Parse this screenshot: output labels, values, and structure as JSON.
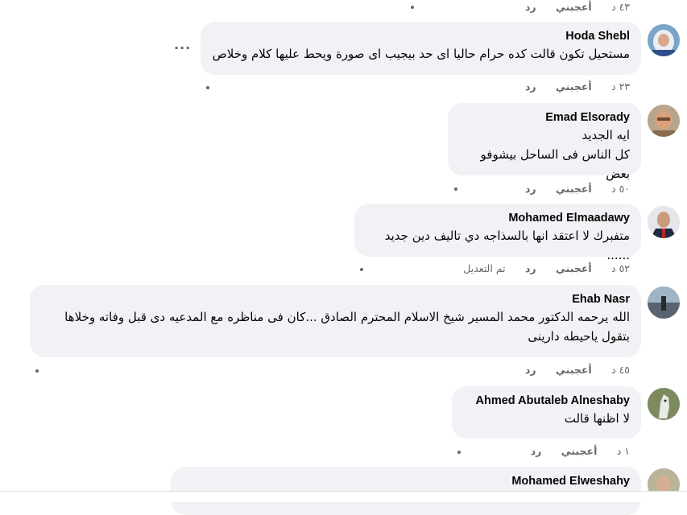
{
  "top_actions": {
    "time": "٤٣ د",
    "like": "أعجبني",
    "reply": "رد"
  },
  "comments": [
    {
      "author": "Hoda Shebl",
      "text": "مستحيل تكون قالت كده حرام حاليا اى حد بيجيب اى صورة ويحط عليها كلام وخلاص",
      "time": "٢٣ د",
      "like": "أعجبني",
      "reply": "رد",
      "more": "···",
      "avatar": "woman-hijab-avatar"
    },
    {
      "author": "Emad Elsorady",
      "text": "ايه الجديد\nكل الناس فى الساحل بيشوفو بعض",
      "time": "٥٠ د",
      "like": "أعجبني",
      "reply": "رد",
      "avatar": "man-glasses-avatar"
    },
    {
      "author": "Mohamed Elmaadawy",
      "text": "متفبرك لا اعتقد انها بالسذاجه دي تاليف دين جديد ......",
      "time": "٥٢ د",
      "like": "أعجبني",
      "reply": "رد",
      "edited": "تم التعديل",
      "avatar": "man-suit-avatar"
    },
    {
      "author": "Ehab Nasr",
      "text": "الله يرحمه الدكتور محمد المسير شيخ الاسلام المحترم الصادق ...كان فى مناظره مع المدعيه دى قبل وفاته وخلاها بتقول ياحيطه دارينى",
      "time": "٤٥ د",
      "like": "أعجبني",
      "reply": "رد",
      "avatar": "seaside-avatar"
    },
    {
      "author": "Ahmed Abutaleb Alneshaby",
      "text": "لا اظنها قالت",
      "time": "١ د",
      "like": "أعجبني",
      "reply": "رد",
      "avatar": "horse-avatar"
    },
    {
      "author": "Mohamed Elweshahy",
      "text": "",
      "avatar": "man-avatar"
    }
  ],
  "colors": {
    "bubble": "#f0f2f5",
    "meta": "#65676b",
    "text": "#050505"
  }
}
